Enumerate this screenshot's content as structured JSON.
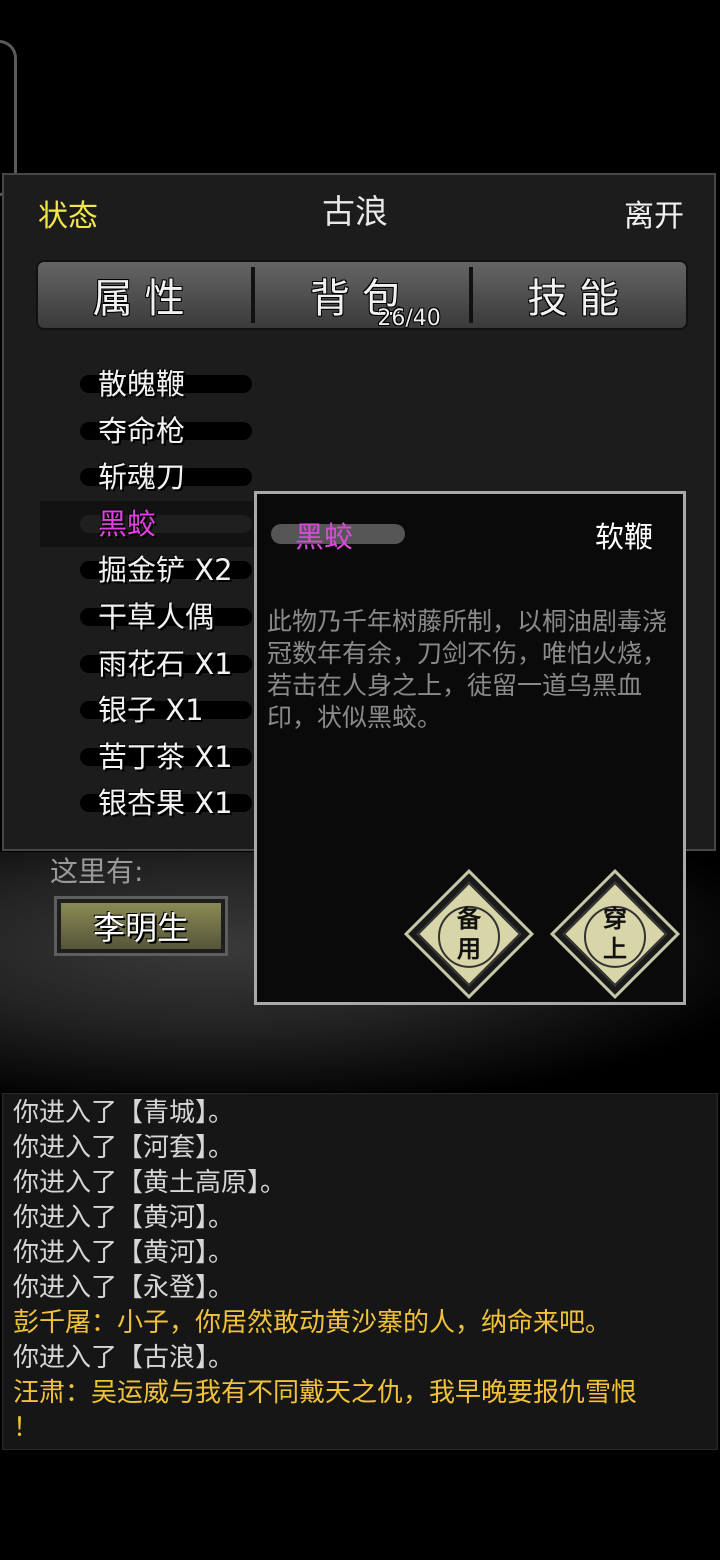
{
  "header": {
    "status_label": "状态",
    "location": "古浪",
    "leave_label": "离开"
  },
  "tabs": {
    "attributes": "属性",
    "bag": "背包",
    "bag_count": "26/40",
    "skills": "技能"
  },
  "inventory": [
    {
      "label": "散魄鞭"
    },
    {
      "label": "夺命枪"
    },
    {
      "label": "斩魂刀"
    },
    {
      "label": "黑蛟",
      "selected": true
    },
    {
      "label": "掘金铲 X2"
    },
    {
      "label": "干草人偶"
    },
    {
      "label": "雨花石 X1"
    },
    {
      "label": "银子 X1"
    },
    {
      "label": "苦丁茶 X1"
    },
    {
      "label": "银杏果 X1"
    }
  ],
  "scene": {
    "here_label": "这里有:",
    "npcs": [
      "李明生",
      "汪肃"
    ]
  },
  "popup": {
    "item_name": "黑蛟",
    "item_type": "软鞭",
    "description": "此物乃千年树藤所制，以桐油剧毒浇冠数年有余，刀剑不伤，唯怕火烧，若击在人身之上，徒留一道乌黑血印，状似黑蛟。",
    "spare_label_1": "备",
    "spare_label_2": "用",
    "equip_label_1": "穿",
    "equip_label_2": "上"
  },
  "log": [
    {
      "text": "你进入了【青城】。",
      "color": "normal"
    },
    {
      "text": "你进入了【河套】。",
      "color": "normal"
    },
    {
      "text": "你进入了【黄土高原】。",
      "color": "normal"
    },
    {
      "text": "你进入了【黄河】。",
      "color": "normal"
    },
    {
      "text": "你进入了【黄河】。",
      "color": "normal"
    },
    {
      "text": "你进入了【永登】。",
      "color": "normal"
    },
    {
      "text": "彭千屠：小子，你居然敢动黄沙寨的人，纳命来吧。",
      "color": "yellow"
    },
    {
      "text": "你进入了【古浪】。",
      "color": "normal"
    },
    {
      "text": "汪肃：吴运威与我有不同戴天之仇，我早晚要报仇雪恨\n！",
      "color": "yellow"
    }
  ],
  "colors": {
    "accent_yellow": "#f2e64a",
    "selected_magenta": "#e040e0",
    "dialog_yellow": "#f0c23a"
  }
}
